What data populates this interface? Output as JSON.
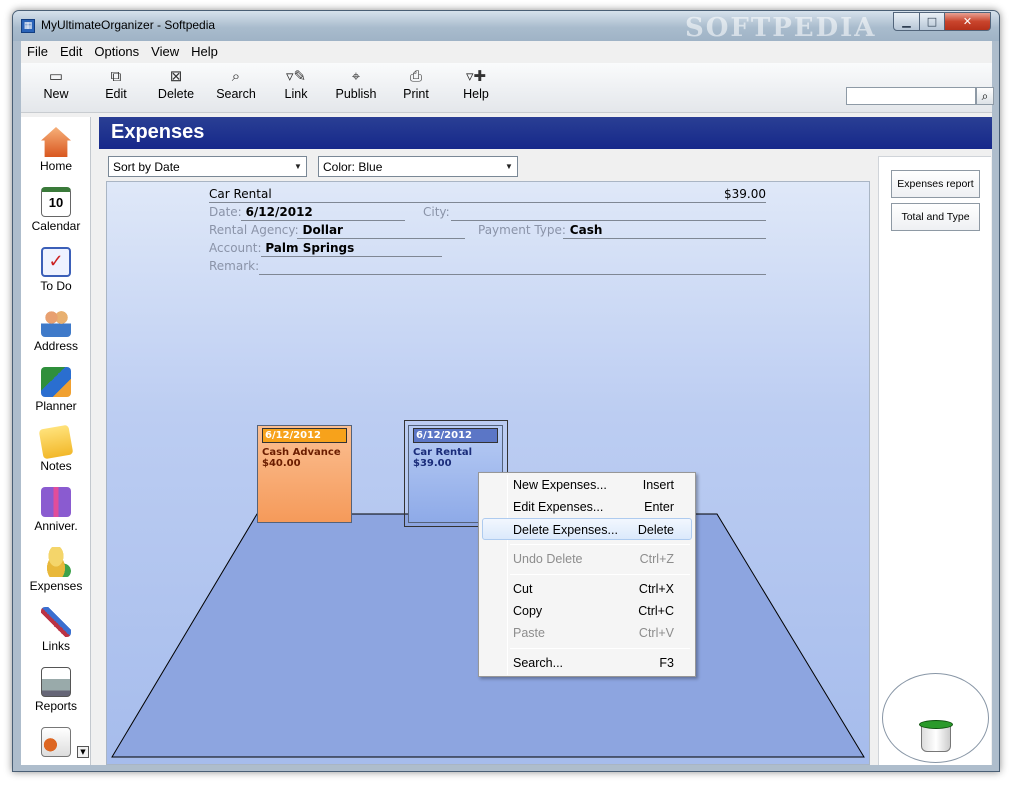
{
  "window": {
    "title": "MyUltimateOrganizer - Softpedia",
    "watermark": "SOFTPEDIA"
  },
  "menu": [
    "File",
    "Edit",
    "Options",
    "View",
    "Help"
  ],
  "toolbar": [
    {
      "label": "New",
      "icon": "new-icon"
    },
    {
      "label": "Edit",
      "icon": "edit-icon"
    },
    {
      "label": "Delete",
      "icon": "delete-icon"
    },
    {
      "label": "Search",
      "icon": "search-icon"
    },
    {
      "label": "Link",
      "icon": "link-icon"
    },
    {
      "label": "Publish",
      "icon": "publish-icon"
    },
    {
      "label": "Print",
      "icon": "print-icon"
    },
    {
      "label": "Help",
      "icon": "help-icon"
    }
  ],
  "search": {
    "value": ""
  },
  "sidebar": [
    {
      "label": "Home",
      "icon": "home-icon"
    },
    {
      "label": "Calendar",
      "icon": "calendar-icon",
      "day": "10"
    },
    {
      "label": "To Do",
      "icon": "todo-icon"
    },
    {
      "label": "Address",
      "icon": "address-icon"
    },
    {
      "label": "Planner",
      "icon": "planner-icon"
    },
    {
      "label": "Notes",
      "icon": "notes-icon"
    },
    {
      "label": "Anniver.",
      "icon": "gift-icon"
    },
    {
      "label": "Expenses",
      "icon": "coins-icon"
    },
    {
      "label": "Links",
      "icon": "links-icon"
    },
    {
      "label": "Reports",
      "icon": "printer-icon"
    },
    {
      "label": "",
      "icon": "password-icon"
    }
  ],
  "header": {
    "title": "Expenses"
  },
  "sort_combo": "Sort by Date",
  "color_combo": "Color: Blue",
  "detail": {
    "title": "Car Rental",
    "amount": "$39.00",
    "date_label": "Date:",
    "date": "6/12/2012",
    "city_label": "City:",
    "city": "",
    "agency_label": "Rental Agency:",
    "agency": "Dollar",
    "payment_label": "Payment Type:",
    "payment": "Cash",
    "account_label": "Account:",
    "account": "Palm Springs",
    "remark_label": "Remark:",
    "remark": ""
  },
  "cards": [
    {
      "date": "6/12/2012",
      "name": "Cash Advance",
      "amount": "$40.00",
      "color": "#f7a66b"
    },
    {
      "date": "6/12/2012",
      "name": "Car Rental",
      "amount": "$39.00",
      "color": "#9fb8ee"
    }
  ],
  "right_panel": {
    "report_button": "Expenses report",
    "total_button": "Total and Type"
  },
  "context_menu": [
    {
      "label": "New Expenses...",
      "key": "Insert",
      "disabled": false
    },
    {
      "label": "Edit Expenses...",
      "key": "Enter",
      "disabled": false
    },
    {
      "label": "Delete Expenses...",
      "key": "Delete",
      "disabled": false
    },
    {
      "label": "Undo Delete",
      "key": "Ctrl+Z",
      "disabled": true
    },
    {
      "label": "Cut",
      "key": "Ctrl+X",
      "disabled": false
    },
    {
      "label": "Copy",
      "key": "Ctrl+C",
      "disabled": false
    },
    {
      "label": "Paste",
      "key": "Ctrl+V",
      "disabled": true
    },
    {
      "label": "Search...",
      "key": "F3",
      "disabled": false
    }
  ]
}
